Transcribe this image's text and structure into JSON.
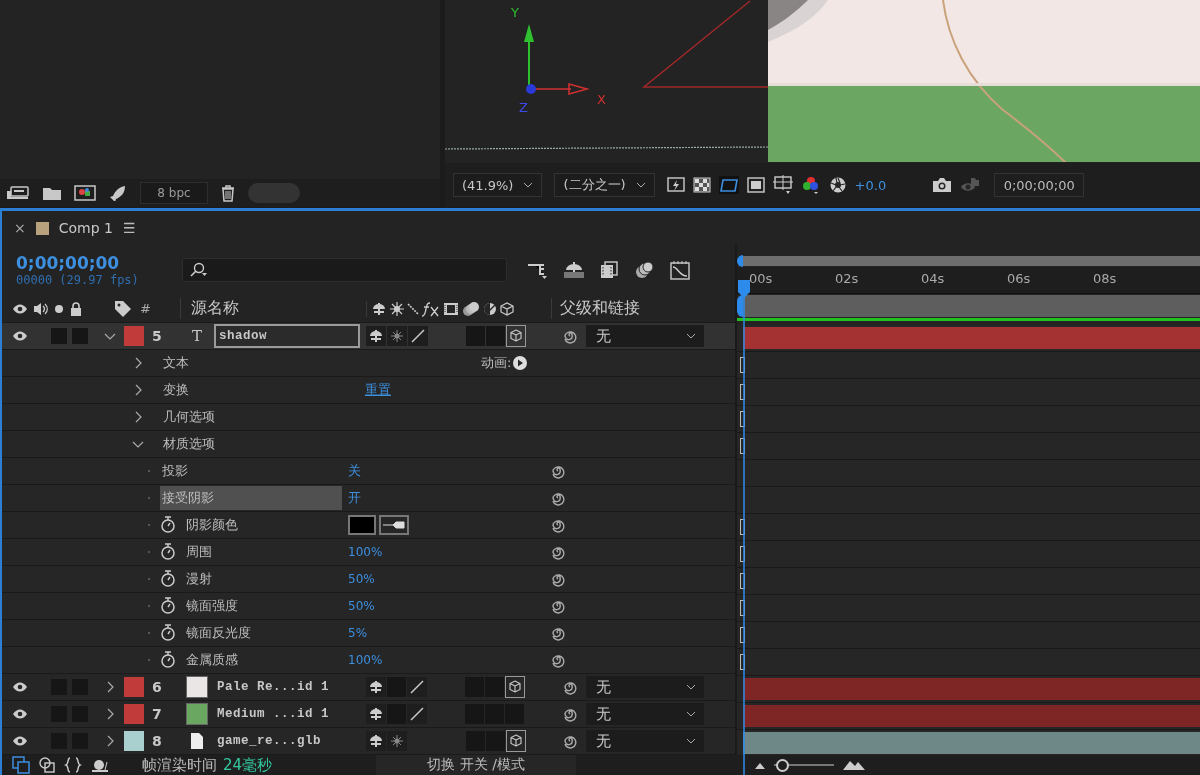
{
  "project_panel": {
    "depth": "8 bpc"
  },
  "viewer": {
    "axis_labels": {
      "y": "Y",
      "z": "Z",
      "x": "X"
    },
    "zoom": "(41.9%)",
    "resolution": "(二分之一)",
    "exposure": "+0.0",
    "timecode": "0;00;00;00"
  },
  "timeline": {
    "tab": {
      "close": "×",
      "title": "Comp 1",
      "menu": "☰",
      "color": "#b8a27e"
    },
    "timecode": "0;00;00;00",
    "frame_info": "00000 (29.97 fps)",
    "columns": {
      "number": "#",
      "source_name": "源名称",
      "parent": "父级和链接"
    },
    "ruler": [
      "00s",
      "02s",
      "04s",
      "06s",
      "08s"
    ],
    "layers": [
      {
        "number": "5",
        "name": "shadow",
        "kind": "text",
        "glyph": "T",
        "color": "#c23b3b",
        "visible": true,
        "expanded": true,
        "selected": true,
        "renaming": true,
        "parent": "无",
        "switches": {
          "three_d": true
        },
        "properties": [
          {
            "name": "文本",
            "kind": "group",
            "expanded": false,
            "value": {
              "kind": "animator",
              "text": "动画:"
            }
          },
          {
            "name": "变换",
            "kind": "group",
            "expanded": false,
            "value": {
              "kind": "link",
              "text": "重置"
            }
          },
          {
            "name": "几何选项",
            "kind": "group",
            "expanded": false
          },
          {
            "name": "材质选项",
            "kind": "group",
            "expanded": true,
            "children": [
              {
                "name": "投影",
                "kind": "option",
                "value": "关",
                "selected": false
              },
              {
                "name": "接受阴影",
                "kind": "option",
                "value": "开",
                "selected": true
              },
              {
                "name": "阴影颜色",
                "kind": "color",
                "color": "#000000",
                "selected": false
              },
              {
                "name": "周围",
                "kind": "number",
                "value": "100%",
                "selected": false
              },
              {
                "name": "漫射",
                "kind": "number",
                "value": "50%",
                "selected": false
              },
              {
                "name": "镜面强度",
                "kind": "number",
                "value": "50%",
                "selected": false
              },
              {
                "name": "镜面反光度",
                "kind": "number",
                "value": "5%",
                "selected": false
              },
              {
                "name": "金属质感",
                "kind": "number",
                "value": "100%",
                "selected": false
              }
            ]
          }
        ]
      },
      {
        "number": "6",
        "name": "Pale Re...id 1",
        "kind": "solid",
        "source": {
          "color": "#ebe6e6"
        },
        "color": "#c23b3b",
        "visible": true,
        "expanded": false,
        "selected": false,
        "renaming": false,
        "parent": "无",
        "switches": {
          "three_d": true
        }
      },
      {
        "number": "7",
        "name": "Medium ...id 1",
        "kind": "solid",
        "source": {
          "color": "#6aa862"
        },
        "color": "#c23b3b",
        "visible": true,
        "expanded": false,
        "selected": false,
        "renaming": false,
        "parent": "无",
        "switches": {
          "three_d": false
        }
      },
      {
        "number": "8",
        "name": "game_re...glb",
        "kind": "file",
        "color": "#a9cfcf",
        "visible": true,
        "expanded": false,
        "selected": false,
        "renaming": false,
        "parent": "无",
        "switches": {
          "three_d": true
        }
      }
    ]
  },
  "status_bar": {
    "render_label": "帧渲染时间",
    "render_time": "24毫秒",
    "toggle": "切换 开关 /模式",
    "zoom": {
      "level": 0.05
    }
  }
}
